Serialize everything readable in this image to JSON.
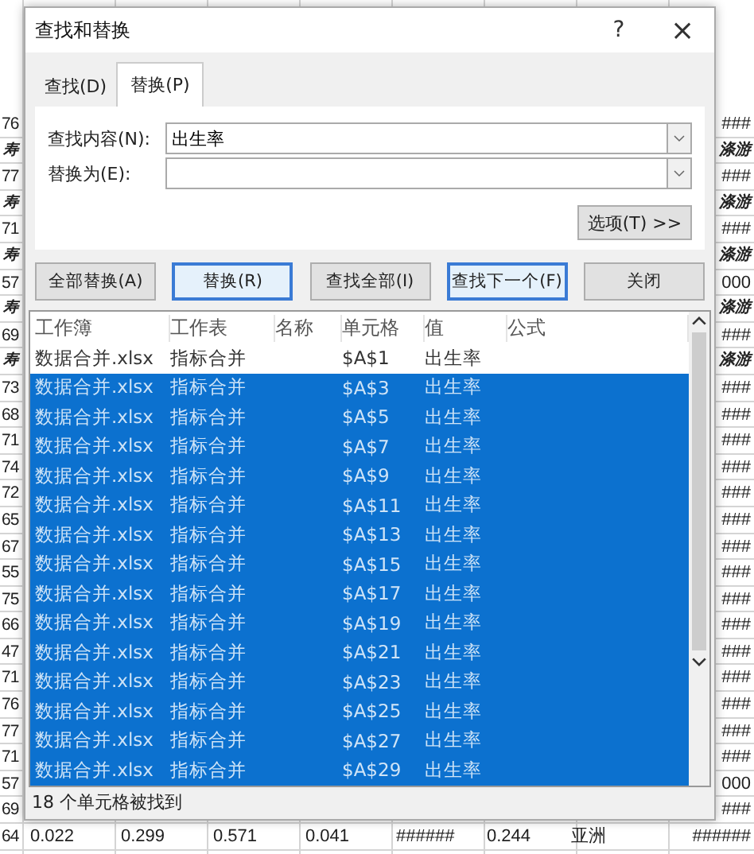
{
  "sheet": {
    "rows": [
      {
        "cells": [
          "76",
          "",
          "",
          "",
          "",
          "",
          "",
          "",
          "###"
        ],
        "bold": false
      },
      {
        "cells": [
          "寿",
          "",
          "",
          "",
          "",
          "",
          "",
          "",
          "涤游"
        ],
        "bold": true
      },
      {
        "cells": [
          "77",
          "",
          "",
          "",
          "",
          "",
          "",
          "",
          "###"
        ],
        "bold": false
      },
      {
        "cells": [
          "寿",
          "",
          "",
          "",
          "",
          "",
          "",
          "",
          "涤游"
        ],
        "bold": true
      },
      {
        "cells": [
          "71",
          "",
          "",
          "",
          "",
          "",
          "",
          "",
          "###"
        ],
        "bold": false
      },
      {
        "cells": [
          "寿",
          "",
          "",
          "",
          "",
          "",
          "",
          "",
          "涤游"
        ],
        "bold": true
      },
      {
        "cells": [
          "57",
          "",
          "",
          "",
          "",
          "",
          "",
          "",
          "000"
        ],
        "bold": false
      },
      {
        "cells": [
          "寿",
          "",
          "",
          "",
          "",
          "",
          "",
          "",
          "涤游"
        ],
        "bold": true
      },
      {
        "cells": [
          "69",
          "",
          "",
          "",
          "",
          "",
          "",
          "",
          "###"
        ],
        "bold": false
      },
      {
        "cells": [
          "寿",
          "",
          "",
          "",
          "",
          "",
          "",
          "",
          "涤游"
        ],
        "bold": true
      },
      {
        "cells": [
          "73",
          "",
          "",
          "",
          "",
          "",
          "",
          "",
          "###"
        ],
        "bold": false
      },
      {
        "cells": [
          "68",
          "",
          "",
          "",
          "",
          "",
          "",
          "",
          "###"
        ],
        "bold": false
      },
      {
        "cells": [
          "71",
          "",
          "",
          "",
          "",
          "",
          "",
          "",
          "###"
        ],
        "bold": false
      },
      {
        "cells": [
          "74",
          "",
          "",
          "",
          "",
          "",
          "",
          "",
          "###"
        ],
        "bold": false
      },
      {
        "cells": [
          "72",
          "",
          "",
          "",
          "",
          "",
          "",
          "",
          "###"
        ],
        "bold": false
      },
      {
        "cells": [
          "65",
          "",
          "",
          "",
          "",
          "",
          "",
          "",
          "###"
        ],
        "bold": false
      },
      {
        "cells": [
          "67",
          "",
          "",
          "",
          "",
          "",
          "",
          "",
          "###"
        ],
        "bold": false
      },
      {
        "cells": [
          "55",
          "",
          "",
          "",
          "",
          "",
          "",
          "",
          "###"
        ],
        "bold": false
      },
      {
        "cells": [
          "75",
          "",
          "",
          "",
          "",
          "",
          "",
          "",
          "###"
        ],
        "bold": false
      },
      {
        "cells": [
          "66",
          "",
          "",
          "",
          "",
          "",
          "",
          "",
          "###"
        ],
        "bold": false
      },
      {
        "cells": [
          "47",
          "",
          "",
          "",
          "",
          "",
          "",
          "",
          "###"
        ],
        "bold": false
      },
      {
        "cells": [
          "71",
          "",
          "",
          "",
          "",
          "",
          "",
          "",
          "###"
        ],
        "bold": false
      },
      {
        "cells": [
          "76",
          "",
          "",
          "",
          "",
          "",
          "",
          "",
          "###"
        ],
        "bold": false
      },
      {
        "cells": [
          "77",
          "",
          "",
          "",
          "",
          "",
          "",
          "",
          "###"
        ],
        "bold": false
      },
      {
        "cells": [
          "71",
          "",
          "",
          "",
          "",
          "",
          "",
          "",
          "###"
        ],
        "bold": false
      },
      {
        "cells": [
          "57",
          "",
          "",
          "",
          "",
          "",
          "",
          "",
          "000"
        ],
        "bold": false
      },
      {
        "cells": [
          "69",
          "",
          "",
          "",
          "",
          "",
          "",
          "",
          "###"
        ],
        "bold": false
      },
      {
        "cells": [
          "64",
          "0.022",
          "0.299",
          "0.571",
          "0.041",
          "######",
          "0.244",
          "亚洲",
          "######"
        ],
        "bold": false
      }
    ]
  },
  "dialog": {
    "title": "查找和替换",
    "help": "?",
    "close": "×",
    "tabs": [
      {
        "label": "查找(D)",
        "selected": false
      },
      {
        "label": "替换(P)",
        "selected": true
      }
    ],
    "find": {
      "label": "查找内容(N):",
      "value": "出生率"
    },
    "replace": {
      "label": "替换为(E):"
    },
    "options_button": "选项(T) >>",
    "buttons": [
      {
        "label": "全部替换(A)",
        "focused": false
      },
      {
        "label": "替换(R)",
        "focused": true
      },
      {
        "label": "查找全部(I)",
        "focused": false
      },
      {
        "label": "查找下一个(F)",
        "focused": true
      },
      {
        "label": "关闭",
        "focused": false
      }
    ],
    "results": {
      "columns": [
        "工作簿",
        "工作表",
        "名称",
        "单元格",
        "值",
        "公式"
      ],
      "rows": [
        {
          "book": "数据合并.xlsx",
          "sheet": "指标合并",
          "cell": "$A$1",
          "value": "出生率",
          "selected": false
        },
        {
          "book": "数据合并.xlsx",
          "sheet": "指标合并",
          "cell": "$A$3",
          "value": "出生率",
          "selected": true
        },
        {
          "book": "数据合并.xlsx",
          "sheet": "指标合并",
          "cell": "$A$5",
          "value": "出生率",
          "selected": true
        },
        {
          "book": "数据合并.xlsx",
          "sheet": "指标合并",
          "cell": "$A$7",
          "value": "出生率",
          "selected": true
        },
        {
          "book": "数据合并.xlsx",
          "sheet": "指标合并",
          "cell": "$A$9",
          "value": "出生率",
          "selected": true
        },
        {
          "book": "数据合并.xlsx",
          "sheet": "指标合并",
          "cell": "$A$11",
          "value": "出生率",
          "selected": true
        },
        {
          "book": "数据合并.xlsx",
          "sheet": "指标合并",
          "cell": "$A$13",
          "value": "出生率",
          "selected": true
        },
        {
          "book": "数据合并.xlsx",
          "sheet": "指标合并",
          "cell": "$A$15",
          "value": "出生率",
          "selected": true
        },
        {
          "book": "数据合并.xlsx",
          "sheet": "指标合并",
          "cell": "$A$17",
          "value": "出生率",
          "selected": true
        },
        {
          "book": "数据合并.xlsx",
          "sheet": "指标合并",
          "cell": "$A$19",
          "value": "出生率",
          "selected": true
        },
        {
          "book": "数据合并.xlsx",
          "sheet": "指标合并",
          "cell": "$A$21",
          "value": "出生率",
          "selected": true
        },
        {
          "book": "数据合并.xlsx",
          "sheet": "指标合并",
          "cell": "$A$23",
          "value": "出生率",
          "selected": true
        },
        {
          "book": "数据合并.xlsx",
          "sheet": "指标合并",
          "cell": "$A$25",
          "value": "出生率",
          "selected": true
        },
        {
          "book": "数据合并.xlsx",
          "sheet": "指标合并",
          "cell": "$A$27",
          "value": "出生率",
          "selected": true
        },
        {
          "book": "数据合并.xlsx",
          "sheet": "指标合并",
          "cell": "$A$29",
          "value": "出生率",
          "selected": true
        }
      ]
    },
    "status": "18 个单元格被找到"
  }
}
